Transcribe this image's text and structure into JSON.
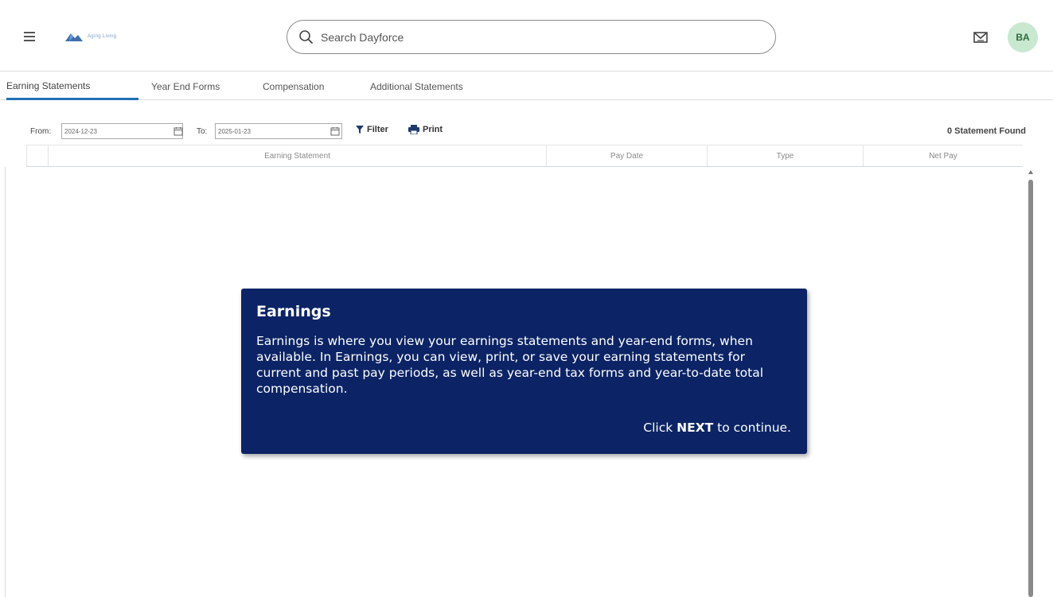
{
  "header": {
    "search_placeholder": "Search Dayforce",
    "avatar_initials": "BA",
    "logo_text": "Aging Living"
  },
  "tabs": [
    {
      "label": "Earning Statements",
      "active": true
    },
    {
      "label": "Year End Forms",
      "active": false
    },
    {
      "label": "Compensation",
      "active": false
    },
    {
      "label": "Additional Statements",
      "active": false
    }
  ],
  "toolbar": {
    "from_label": "From:",
    "from_value": "2024-12-23",
    "to_label": "To:",
    "to_value": "2025-01-23",
    "filter_label": "Filter",
    "print_label": "Print",
    "found_text": "0 Statement Found"
  },
  "table": {
    "columns": [
      "Earning Statement",
      "Pay Date",
      "Type",
      "Net Pay"
    ]
  },
  "tooltip": {
    "title": "Earnings",
    "body": "Earnings is where you view your earnings statements and year-end forms, when available. In Earnings, you can view, print, or save your earning statements for current and past pay periods, as well as year-end tax forms and year-to-date total compensation.",
    "next_prefix": "Click ",
    "next_keyword": "NEXT",
    "next_suffix": " to continue."
  },
  "colors": {
    "tooltip_bg": "#0c2466",
    "active_tab": "#1f6fb5",
    "avatar_bg": "#c8e8cf"
  }
}
